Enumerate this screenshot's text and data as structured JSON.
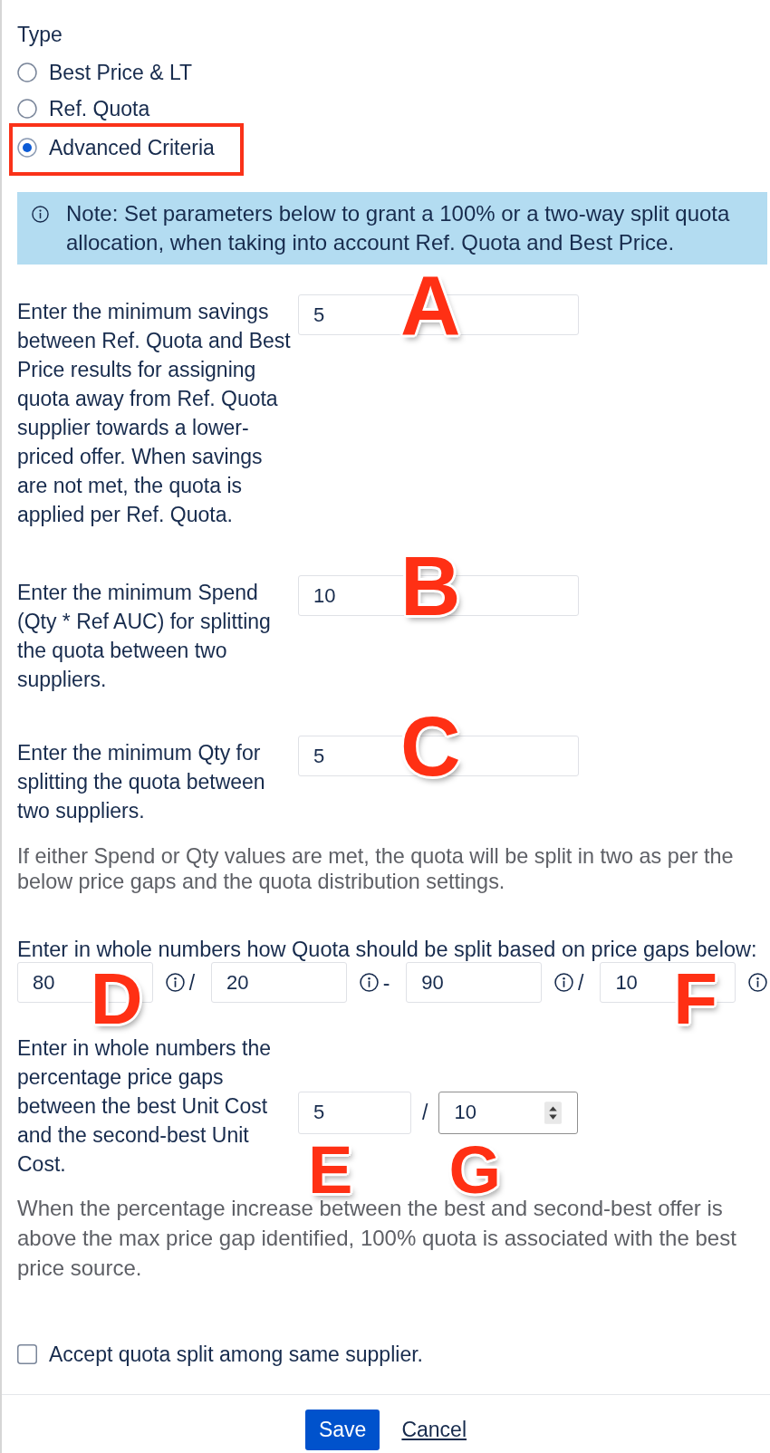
{
  "type_group": {
    "label": "Type",
    "options": [
      {
        "label": "Best Price & LT",
        "selected": false,
        "highlighted": false
      },
      {
        "label": "Ref. Quota",
        "selected": false,
        "highlighted": false
      },
      {
        "label": "Advanced Criteria",
        "selected": true,
        "highlighted": true
      }
    ]
  },
  "note": {
    "text": "Note: Set parameters below to grant a 100% or a two-way split quota allocation, when taking into account Ref. Quota and Best Price."
  },
  "settings": [
    {
      "kind": "single",
      "label": "Enter the minimum savings between Ref. Quota and Best Price results for assigning quota away from Ref. Quota supplier towards a lower-priced offer. When savings are not met, the quota is applied per Ref. Quota.",
      "value": "5",
      "marker": "A"
    },
    {
      "kind": "single",
      "label": "Enter the minimum Spend (Qty * Ref AUC) for splitting the quota between two suppliers.",
      "value": "10",
      "marker": "B"
    },
    {
      "kind": "single",
      "label": "Enter the minimum Qty for splitting the quota between two suppliers.",
      "value": "5",
      "marker": "C"
    },
    {
      "kind": "help",
      "text": "If either Spend or Qty values are met, the quota will be split in two as per the below price gaps and the quota distribution settings."
    },
    {
      "kind": "split",
      "label": "Enter in whole numbers how Quota should be split based on price gaps below:",
      "fields": [
        {
          "value": "80",
          "marker": "D",
          "separator": "/"
        },
        {
          "value": "20",
          "separator": "-"
        },
        {
          "value": "90",
          "separator": "/"
        },
        {
          "value": "10",
          "marker": "F"
        }
      ]
    },
    {
      "kind": "pair",
      "label": "Enter in whole numbers the percentage price gaps between the best Unit Cost and the second-best Unit Cost.",
      "separator": "/",
      "fields": [
        {
          "value": "5",
          "marker": "E",
          "hovered": false
        },
        {
          "value": "10",
          "marker": "G",
          "hovered": true
        }
      ]
    },
    {
      "kind": "help",
      "text": "When the percentage increase between the best and second-best offer is above the max price gap identified, 100% quota is associated with the best price source."
    }
  ],
  "checkbox": {
    "label": "Accept quota split among same supplier.",
    "checked": false
  },
  "buttons": [
    {
      "kind": "primary",
      "label": "Save"
    },
    {
      "kind": "link",
      "label": "Cancel"
    }
  ]
}
